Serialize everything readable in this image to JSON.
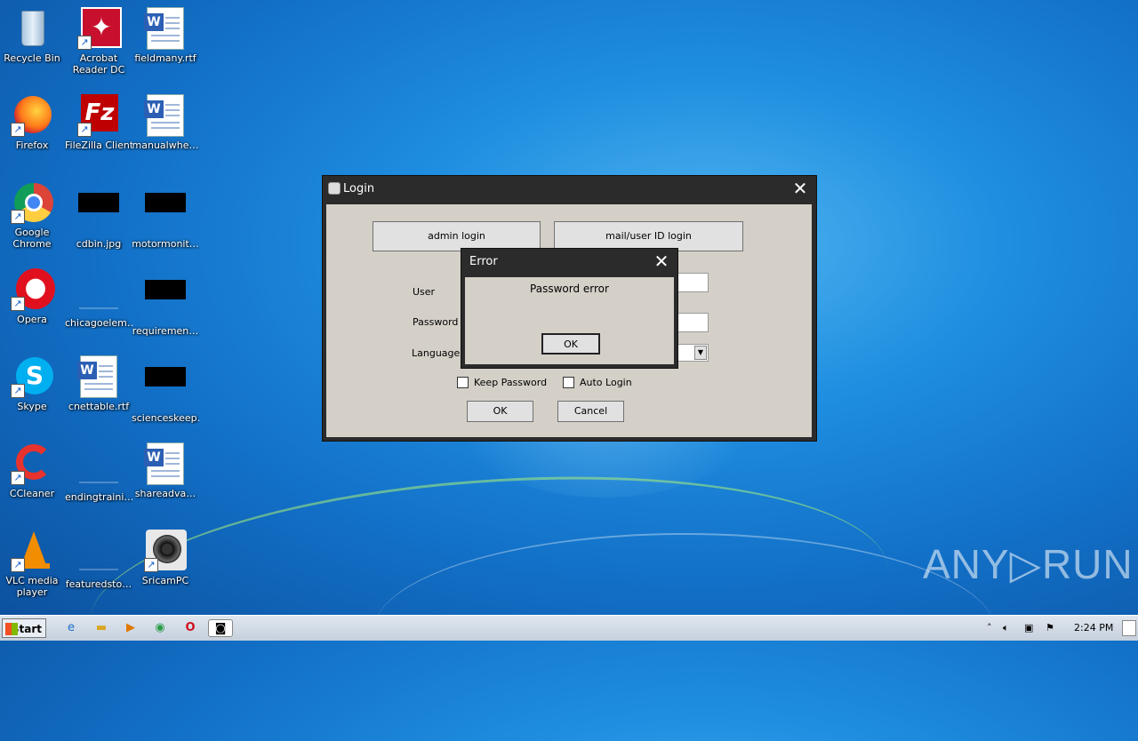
{
  "desktop": {
    "icons": [
      {
        "label": "Recycle Bin",
        "icon": "recycle-bin-icon"
      },
      {
        "label": "Acrobat Reader DC",
        "icon": "acrobat-icon"
      },
      {
        "label": "fieldmany.rtf",
        "icon": "word-document-icon"
      },
      {
        "label": "Firefox",
        "icon": "firefox-icon"
      },
      {
        "label": "FileZilla Client",
        "icon": "filezilla-icon"
      },
      {
        "label": "manualwhe…",
        "icon": "word-document-icon"
      },
      {
        "label": "Google Chrome",
        "icon": "chrome-icon"
      },
      {
        "label": "cdbin.jpg",
        "icon": "image-file-icon"
      },
      {
        "label": "motormonit…",
        "icon": "file-icon"
      },
      {
        "label": "Opera",
        "icon": "opera-icon"
      },
      {
        "label": "chicagoelem…",
        "icon": "file-icon"
      },
      {
        "label": "requiremen…",
        "icon": "file-icon"
      },
      {
        "label": "Skype",
        "icon": "skype-icon"
      },
      {
        "label": "cnettable.rtf",
        "icon": "word-document-icon"
      },
      {
        "label": "scienceskeep…",
        "icon": "file-icon"
      },
      {
        "label": "CCleaner",
        "icon": "ccleaner-icon"
      },
      {
        "label": "endingtraini…",
        "icon": "file-icon"
      },
      {
        "label": "shareadva…",
        "icon": "word-document-icon"
      },
      {
        "label": "VLC media player",
        "icon": "vlc-icon"
      },
      {
        "label": "featuredsto…",
        "icon": "file-icon"
      },
      {
        "label": "SricamPC",
        "icon": "sricam-icon"
      }
    ]
  },
  "login_window": {
    "title": "Login",
    "admin_login": "admin login",
    "mail_login": "mail/user ID login",
    "user_label": "User",
    "password_label": "Password",
    "language_label": "Language",
    "keep_password": "Keep Password",
    "auto_login": "Auto Login",
    "ok": "OK",
    "cancel": "Cancel"
  },
  "error_dialog": {
    "title": "Error",
    "message": "Password error",
    "ok": "OK"
  },
  "taskbar": {
    "start": "Start",
    "clock": "2:24 PM"
  },
  "watermark": "ANY▷RUN"
}
